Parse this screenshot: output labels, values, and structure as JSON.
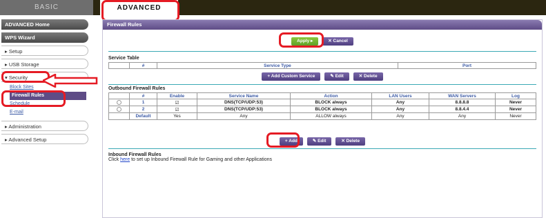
{
  "tabs": {
    "basic": "BASIC",
    "advanced": "ADVANCED"
  },
  "sidebar": {
    "advanced_home": "ADVANCED Home",
    "wps_wizard": "WPS Wizard",
    "setup": "▸ Setup",
    "usb_storage": "▸ USB Storage",
    "security": "▾ Security",
    "sub_items": [
      "Block Sites",
      "Firewall Rules",
      "Schedule",
      "E-mail"
    ],
    "administration": "▸ Administration",
    "advanced_setup": "▸ Advanced Setup"
  },
  "panel": {
    "title": "Firewall Rules",
    "apply": "Apply ▸",
    "cancel": "✕ Cancel"
  },
  "service_table": {
    "title": "Service Table",
    "headers": [
      "",
      "#",
      "Service Type",
      "Port"
    ],
    "buttons": {
      "add_custom": "+ Add Custom Service",
      "edit": "✎ Edit",
      "delete": "✕ Delete"
    }
  },
  "outbound": {
    "title": "Outbound Firewall Rules",
    "headers": [
      "",
      "#",
      "Enable",
      "Service Name",
      "Action",
      "LAN Users",
      "WAN Servers",
      "Log"
    ],
    "rows": [
      {
        "num": "1",
        "enable": "☑",
        "service": "DNS(TCP/UDP:53)",
        "action": "BLOCK always",
        "lan": "Any",
        "wan": "8.8.8.8",
        "log": "Never"
      },
      {
        "num": "2",
        "enable": "☑",
        "service": "DNS(TCP/UDP:53)",
        "action": "BLOCK always",
        "lan": "Any",
        "wan": "8.8.4.4",
        "log": "Never"
      }
    ],
    "default_row": {
      "num": "Default",
      "enable": "Yes",
      "service": "Any",
      "action": "ALLOW always",
      "lan": "Any",
      "wan": "Any",
      "log": "Never"
    },
    "buttons": {
      "add": "+ Add",
      "edit": "✎ Edit",
      "delete": "✕ Delete"
    }
  },
  "inbound": {
    "title": "Inbound Firewall Rules",
    "text_before": "Click ",
    "link": "here",
    "text_after": " to set up Inbound Firewall Rule for Gaming and other Applications"
  },
  "colors": {
    "accent_red": "#e51b24",
    "header_purple": "#5e4c86",
    "rule_teal": "#3aa9b5",
    "apply_green": "#6fb030"
  }
}
